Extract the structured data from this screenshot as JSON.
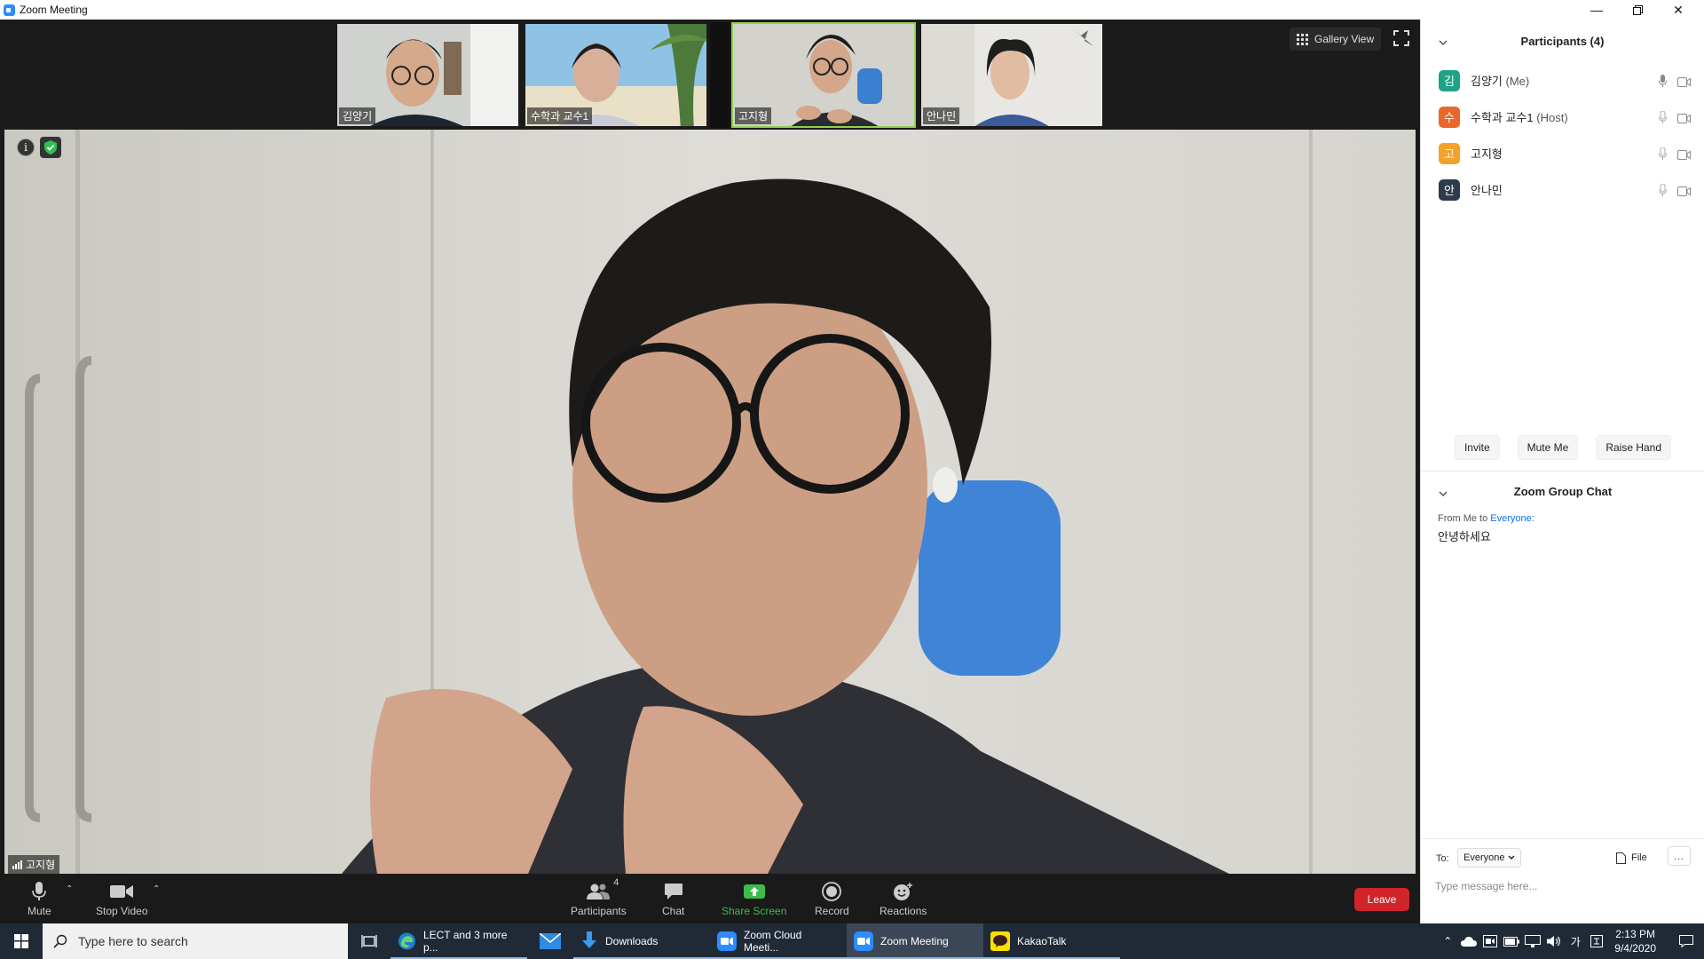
{
  "window": {
    "title": "Zoom Meeting"
  },
  "thumbnails": [
    {
      "name": "김양기"
    },
    {
      "name": "수학과 교수1"
    },
    {
      "name": "고지형"
    },
    {
      "name": "안나민"
    }
  ],
  "view": {
    "gallery_label": "Gallery View"
  },
  "main_video": {
    "speaker_name": "고지형"
  },
  "toolbar": {
    "mute_label": "Mute",
    "stop_video_label": "Stop Video",
    "participants_label": "Participants",
    "participants_count": "4",
    "chat_label": "Chat",
    "share_label": "Share Screen",
    "record_label": "Record",
    "reactions_label": "Reactions",
    "leave_label": "Leave"
  },
  "participants_panel": {
    "title": "Participants (4)",
    "list": [
      {
        "initial": "김",
        "name": "김양기",
        "role": "(Me)",
        "color": "#1fa387"
      },
      {
        "initial": "수",
        "name": "수학과 교수1",
        "role": "(Host)",
        "color": "#e8672a"
      },
      {
        "initial": "고",
        "name": "고지형",
        "role": "",
        "color": "#f3a229"
      },
      {
        "initial": "안",
        "name": "안나민",
        "role": "",
        "color": "#2e3b4e"
      }
    ],
    "actions": {
      "invite": "Invite",
      "mute_me": "Mute Me",
      "raise_hand": "Raise Hand"
    }
  },
  "chat": {
    "title": "Zoom Group Chat",
    "from_prefix": "From Me to",
    "from_to": "Everyone:",
    "message": "안녕하세요",
    "to_label": "To:",
    "to_value": "Everyone",
    "file_label": "File",
    "placeholder": "Type message here..."
  },
  "taskbar": {
    "search_placeholder": "Type here to search",
    "apps": [
      {
        "label": "LECT and 3 more p...",
        "icon": "edge-icon"
      },
      {
        "label": "",
        "icon": "mail-icon"
      },
      {
        "label": "Downloads",
        "icon": "download-icon"
      },
      {
        "label": "Zoom Cloud Meeti...",
        "icon": "zoom-icon"
      },
      {
        "label": "Zoom Meeting",
        "icon": "zoom-icon"
      },
      {
        "label": "KakaoTalk",
        "icon": "kakaotalk-icon"
      }
    ],
    "ime": "가",
    "time": "2:13 PM",
    "date": "9/4/2020"
  },
  "colors": {
    "zoom_blue": "#2d8cff",
    "share_green": "#3cbc4a",
    "leave_red": "#d1242a",
    "active_border": "#8fd14f",
    "link_blue": "#0e72ed"
  }
}
